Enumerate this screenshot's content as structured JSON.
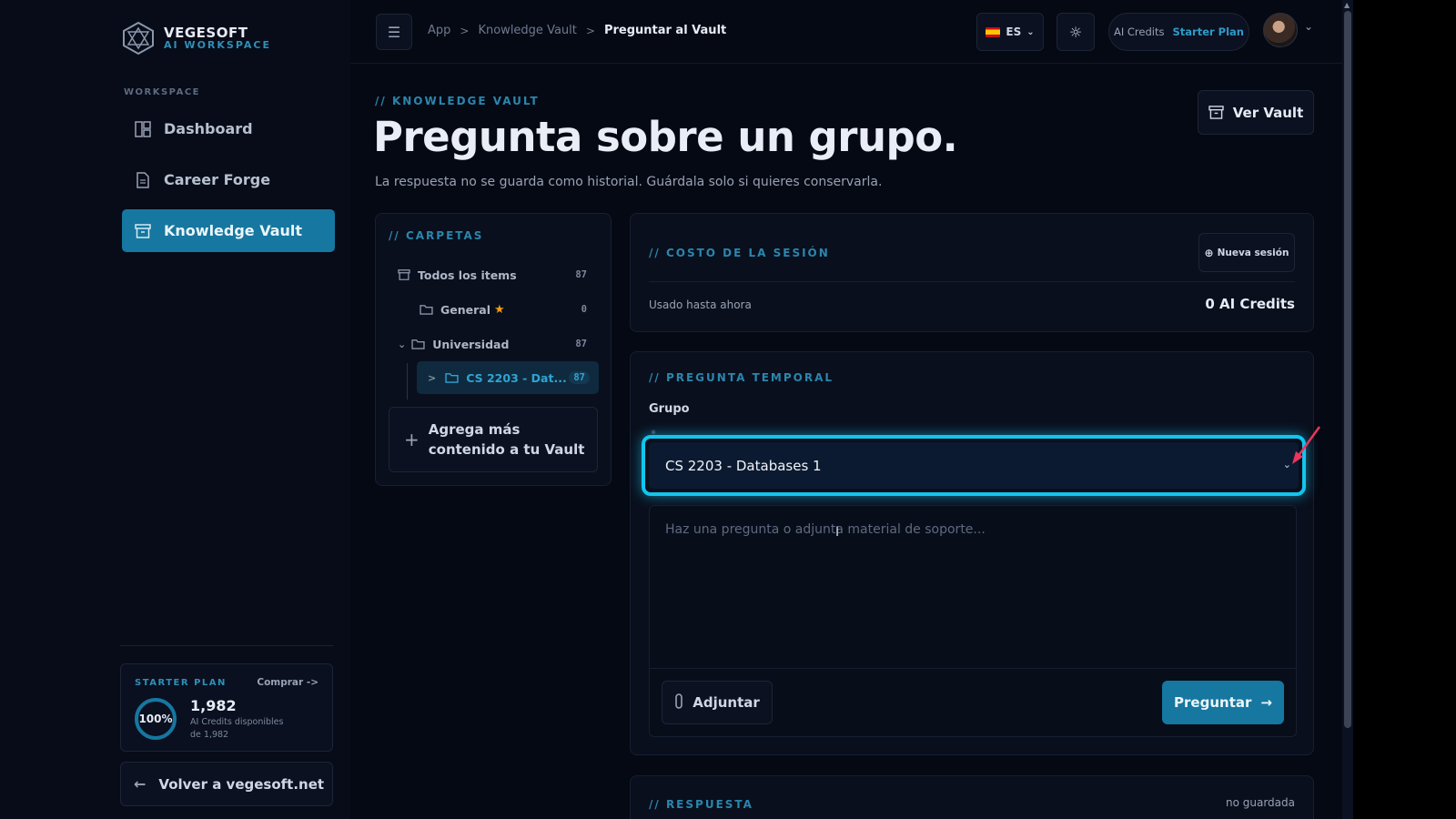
{
  "brand": {
    "name": "VEGESOFT",
    "sub": "AI WORKSPACE"
  },
  "sidebar": {
    "section": "WORKSPACE",
    "items": [
      {
        "label": "Dashboard",
        "icon": "dashboard-icon"
      },
      {
        "label": "Career Forge",
        "icon": "document-icon"
      },
      {
        "label": "Knowledge Vault",
        "icon": "archive-icon",
        "active": true
      }
    ],
    "plan": {
      "title": "STARTER PLAN",
      "buy": "Comprar ->",
      "percent": "100%",
      "credits": "1,982",
      "desc1": "AI Credits disponibles",
      "desc2": "de 1,982"
    },
    "back": "Volver a vegesoft.net"
  },
  "topbar": {
    "breadcrumbs": [
      "App",
      "Knowledge Vault",
      "Preguntar al Vault"
    ],
    "lang": "ES",
    "credits_label": "AI Credits",
    "plan": "Starter Plan"
  },
  "header": {
    "eyebrow": "// KNOWLEDGE VAULT",
    "title": "Pregunta sobre un grupo.",
    "subtitle": "La respuesta no se guarda como historial. Guárdala solo si quieres conservarla.",
    "vault_button": "Ver Vault"
  },
  "folders": {
    "title": "// CARPETAS",
    "rows": [
      {
        "label": "Todos los items",
        "count": "87"
      },
      {
        "label": "General",
        "count": "0",
        "starred": true
      },
      {
        "label": "Universidad",
        "count": "87",
        "expanded": true
      },
      {
        "label": "CS 2203 - Dat...",
        "count": "87",
        "active": true
      }
    ],
    "add_line1": "Agrega más",
    "add_line2": "contenido a tu Vault"
  },
  "cost": {
    "title": "// COSTO DE LA SESIÓN",
    "new_session": "Nueva sesión",
    "used_label": "Usado hasta ahora",
    "used_value": "0 AI Credits"
  },
  "ask": {
    "title": "// PREGUNTA TEMPORAL",
    "group_label": "Grupo",
    "required_mark": "*",
    "group_value": "CS 2203 - Databases 1",
    "placeholder": "Haz una pregunta o adjunta material de soporte...",
    "attach": "Adjuntar",
    "submit": "Preguntar"
  },
  "answer": {
    "title": "// RESPUESTA",
    "status": "no guardada"
  },
  "colors": {
    "accent": "#1677a0",
    "highlight": "#12c5ee",
    "annotation": "#e8365d"
  }
}
